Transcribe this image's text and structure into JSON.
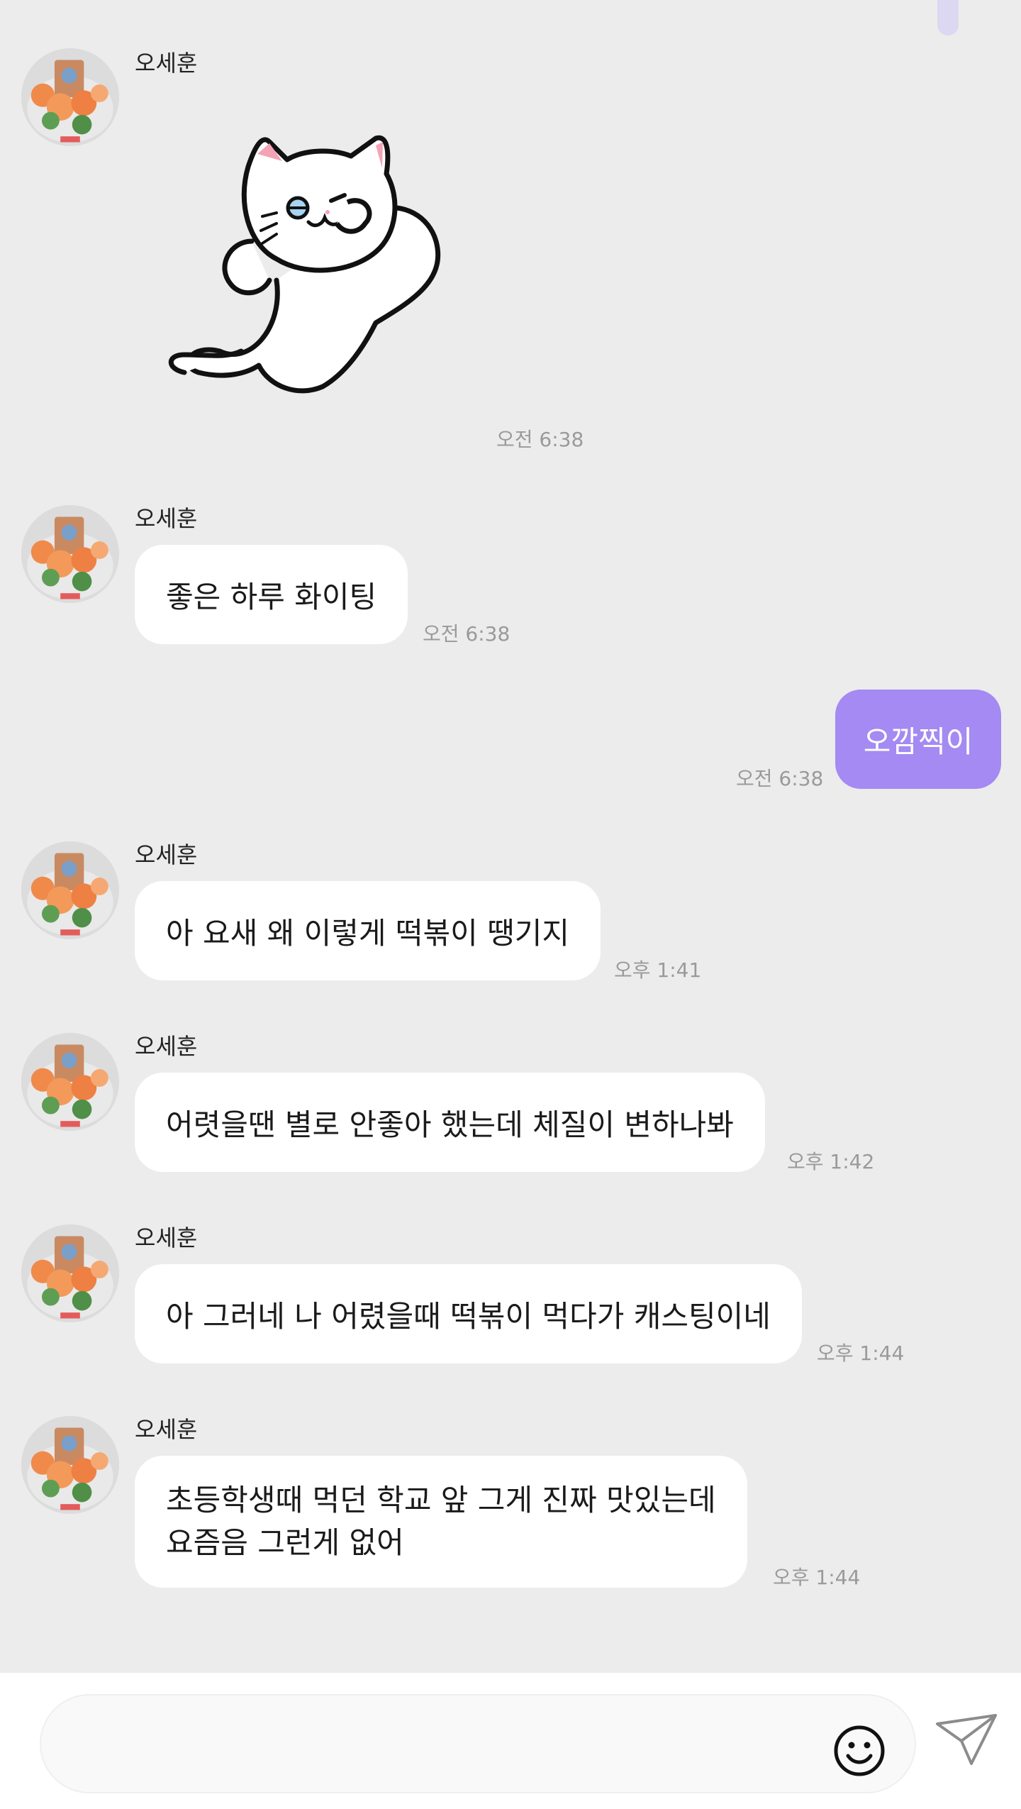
{
  "messages": [
    {
      "sender": "오세훈",
      "type": "sticker",
      "sticker": "winking-white-cat-sticker",
      "time": "오전 6:38"
    },
    {
      "sender": "오세훈",
      "text": "좋은 하루 화이팅",
      "time": "오전 6:38"
    },
    {
      "mine": true,
      "text": "오깜찍이",
      "time": "오전 6:38"
    },
    {
      "sender": "오세훈",
      "text": "아 요새 왜 이렇게 떡볶이 땡기지",
      "time": "오후 1:41"
    },
    {
      "sender": "오세훈",
      "text": "어렷을땐 별로 안좋아 했는데 체질이 변하나봐",
      "time": "오후 1:42"
    },
    {
      "sender": "오세훈",
      "text": "아 그러네 나 어렸을때 떡볶이 먹다가 캐스팅이네",
      "time": "오후 1:44"
    },
    {
      "sender": "오세훈",
      "lines": [
        "초등학생때 먹던 학교 앞 그게 진짜 맛있는데",
        "요즘음 그런게 없어"
      ],
      "time": "오후 1:44"
    }
  ],
  "composer": {
    "input_value": "",
    "emoji_icon": "smiley-icon",
    "send_icon": "paper-plane-icon"
  },
  "colors": {
    "background": "#ececec",
    "my_bubble": "#a48af2",
    "their_bubble": "#ffffff",
    "timestamp": "#9a9a9a"
  }
}
